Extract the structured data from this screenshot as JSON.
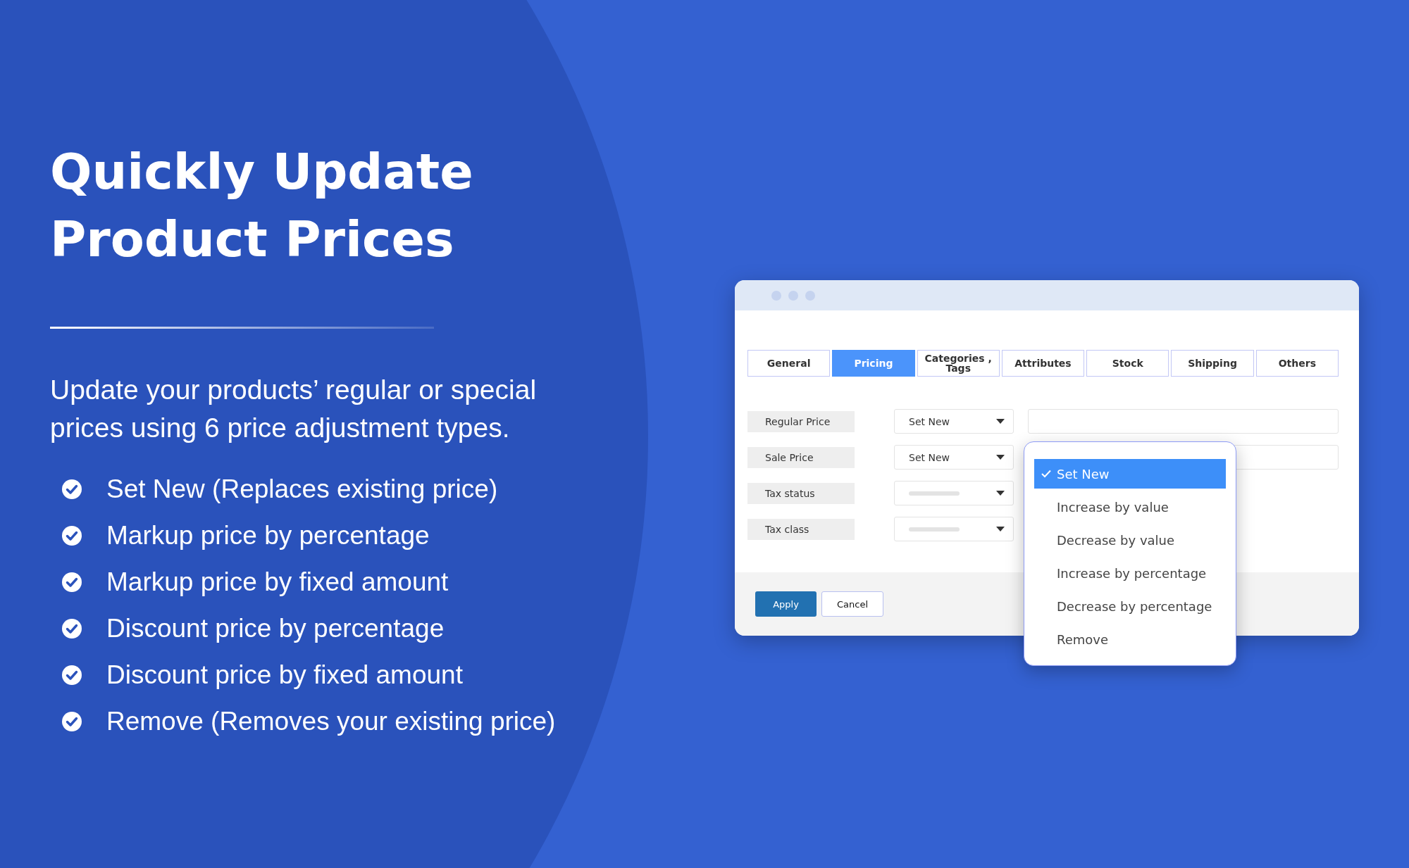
{
  "headline": "Quickly Update Product Prices",
  "intro": "Update your products’ regular or special prices using 6 price adjustment types.",
  "features": [
    "Set New (Replaces existing price)",
    "Markup price by percentage",
    "Markup price by fixed amount",
    "Discount price by percentage",
    "Discount price by fixed amount",
    "Remove (Removes your existing price)"
  ],
  "window": {
    "tabs": [
      {
        "label": "General",
        "selected": false
      },
      {
        "label": "Pricing",
        "selected": true
      },
      {
        "label": "Categories , Tags",
        "selected": false
      },
      {
        "label": "Attributes",
        "selected": false
      },
      {
        "label": "Stock",
        "selected": false
      },
      {
        "label": "Shipping",
        "selected": false
      },
      {
        "label": "Others",
        "selected": false
      }
    ],
    "fields": [
      {
        "label": "Regular Price",
        "select_value": "Set New",
        "input": true
      },
      {
        "label": "Sale Price",
        "select_value": "Set New",
        "input": true
      },
      {
        "label": "Tax status",
        "input": false
      },
      {
        "label": "Tax class",
        "input": false
      }
    ],
    "dropdown": [
      {
        "label": "Set New",
        "selected": true
      },
      {
        "label": "Increase by value",
        "selected": false
      },
      {
        "label": "Decrease by value",
        "selected": false
      },
      {
        "label": "Increase by percentage",
        "selected": false
      },
      {
        "label": "Decrease by percentage",
        "selected": false
      },
      {
        "label": "Remove",
        "selected": false
      }
    ],
    "buttons": [
      {
        "label": "Apply",
        "kind": "primary"
      },
      {
        "label": "Cancel",
        "kind": "secondary"
      }
    ]
  }
}
